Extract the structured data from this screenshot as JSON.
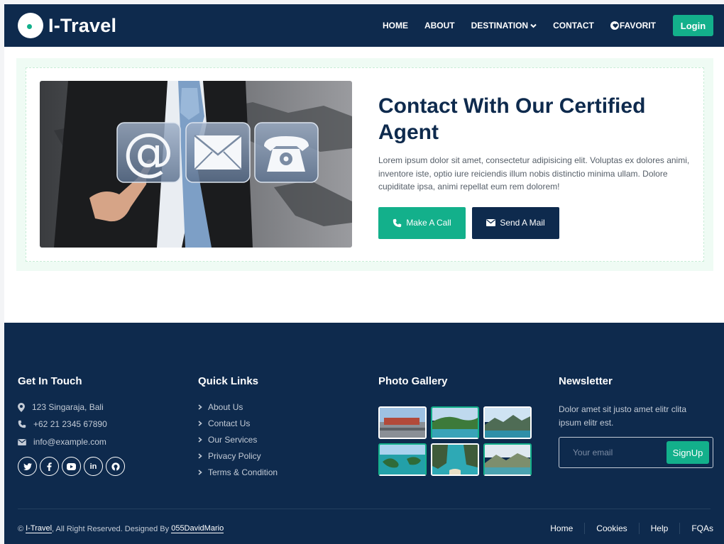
{
  "brand": {
    "name": "I-Travel"
  },
  "nav": {
    "items": [
      {
        "label": "HOME"
      },
      {
        "label": "ABOUT"
      },
      {
        "label": "DESTINATION"
      },
      {
        "label": "CONTACT"
      },
      {
        "label": "FAVORIT"
      }
    ],
    "login_label": "Login"
  },
  "contact": {
    "title": "Contact With Our Certified Agent",
    "description": "Lorem ipsum dolor sit amet, consectetur adipisicing elit. Voluptas ex dolores animi, inventore iste, optio iure reiciendis illum nobis distinctio minima ullam. Dolore cupiditate ipsa, animi repellat eum rem dolorem!",
    "call_label": "Make A Call",
    "mail_label": "Send A Mail"
  },
  "footer": {
    "touch": {
      "title": "Get In Touch",
      "address": "123 Singaraja, Bali",
      "phone": "+62 21 2345 67890",
      "email": "info@example.com",
      "socials": [
        "twitter-icon",
        "facebook-icon",
        "youtube-icon",
        "linkedin-icon",
        "github-icon"
      ]
    },
    "quick_links": {
      "title": "Quick Links",
      "items": [
        {
          "label": "About Us"
        },
        {
          "label": "Contact Us"
        },
        {
          "label": "Our Services"
        },
        {
          "label": "Privacy Policy"
        },
        {
          "label": "Terms & Condition"
        }
      ]
    },
    "gallery": {
      "title": "Photo Gallery"
    },
    "newsletter": {
      "title": "Newsletter",
      "description": "Dolor amet sit justo amet elitr clita ipsum elitr est.",
      "placeholder": "Your email",
      "button_label": "SignUp"
    },
    "copyright": {
      "prefix": "©",
      "brand": "I-Travel",
      "middle": ", All Right Reserved. Designed By",
      "designer": "055DavidMario"
    },
    "menu": [
      {
        "label": "Home"
      },
      {
        "label": "Cookies"
      },
      {
        "label": "Help"
      },
      {
        "label": "FQAs"
      }
    ]
  },
  "colors": {
    "navy": "#0e2a4d",
    "accent": "#13b08b",
    "text_muted": "#c3cbd6"
  }
}
